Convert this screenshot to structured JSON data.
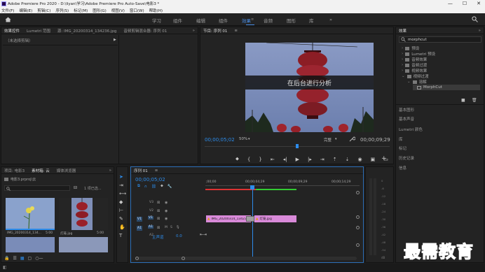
{
  "title_bar": {
    "title": "Adobe Premiere Pro 2020 - D:\\liyan\\学习\\Adobe Premiere Pro Auto-Save\\电影3 *",
    "min": "—",
    "max": "☐",
    "close": "✕"
  },
  "menu": [
    "文件(F)",
    "编辑(E)",
    "剪辑(C)",
    "序列(S)",
    "标记(M)",
    "图形(G)",
    "视图(V)",
    "窗口(W)",
    "帮助(H)"
  ],
  "workspaces": {
    "items": [
      "学习",
      "组件",
      "编辑",
      "组件",
      "效果",
      "音频",
      "图形",
      "库"
    ],
    "active_index": 4,
    "more": "»"
  },
  "effects_panel": {
    "tabs": [
      "效果控件",
      "Lumetri 范围",
      "源: IMG_20200314_134236.jpg",
      "音频剪辑混合器: 序列 01"
    ],
    "more": "»",
    "no_clip": "（未选择剪辑）"
  },
  "program": {
    "tab": "节目: 序列 01",
    "menu_icon": "≡",
    "subtitle": "在后台进行分析",
    "timecode": "00;00;05;02",
    "zoom": "50%",
    "quality": "完整",
    "duration": "00;00;09;29",
    "playhead_position": 0.5
  },
  "project_panel": {
    "tabs": [
      "项目: 电影3",
      "素材箱: 云",
      "媒体浏览器"
    ],
    "more": "»",
    "path": "电影3.prproj\\云",
    "count": "1 项已选...",
    "items": [
      {
        "name": "IMG_20200314_134...",
        "dur": "5:00"
      },
      {
        "name": "灯笼.jpg",
        "dur": "5:00"
      }
    ]
  },
  "timeline": {
    "tab": "序列 01",
    "menu_icon": "≡",
    "timecode": "00;00;05;02",
    "ruler": [
      ";00;00",
      "00;00;04;29",
      "00;00;09;29",
      "00;00;14;29"
    ],
    "tracks": [
      {
        "id": "V3",
        "target": ""
      },
      {
        "id": "V2",
        "target": ""
      },
      {
        "id": "V1",
        "target": "V1"
      },
      {
        "id": "A1",
        "target": "A1"
      },
      {
        "id": "A2",
        "target": ""
      },
      {
        "id": "A3",
        "target": ""
      }
    ],
    "master": "主声道",
    "master_val": "0.0",
    "clips": [
      {
        "label": "IMG_20200314_134236.jpg"
      },
      {
        "label": "灯笼.jpg"
      }
    ],
    "track_mutes": [
      "M",
      "S"
    ],
    "toggle_icons": [
      "M",
      "S",
      "🎙"
    ]
  },
  "effects_browser": {
    "header": "效果",
    "search_value": "morphcut",
    "items": [
      "预设",
      "Lumetri 预设",
      "音频效果",
      "音频过渡",
      "视频效果",
      "视频过渡",
      "溶解",
      "MorphCut"
    ],
    "sections": [
      "基本图形",
      "基本声音",
      "Lumetri 颜色",
      "库",
      "标记",
      "历史记录",
      "信息"
    ],
    "more": "»"
  },
  "meter_scale": [
    "0",
    "-6",
    "-12",
    "-18",
    "-24",
    "-30",
    "-36",
    "-42",
    "-48",
    "-54"
  ],
  "meter_db": "dB",
  "watermark": "最需教育",
  "colors": {
    "accent": "#2d8ceb",
    "clip": "#d98ad9",
    "workspace_active": "#4a8fe7"
  }
}
